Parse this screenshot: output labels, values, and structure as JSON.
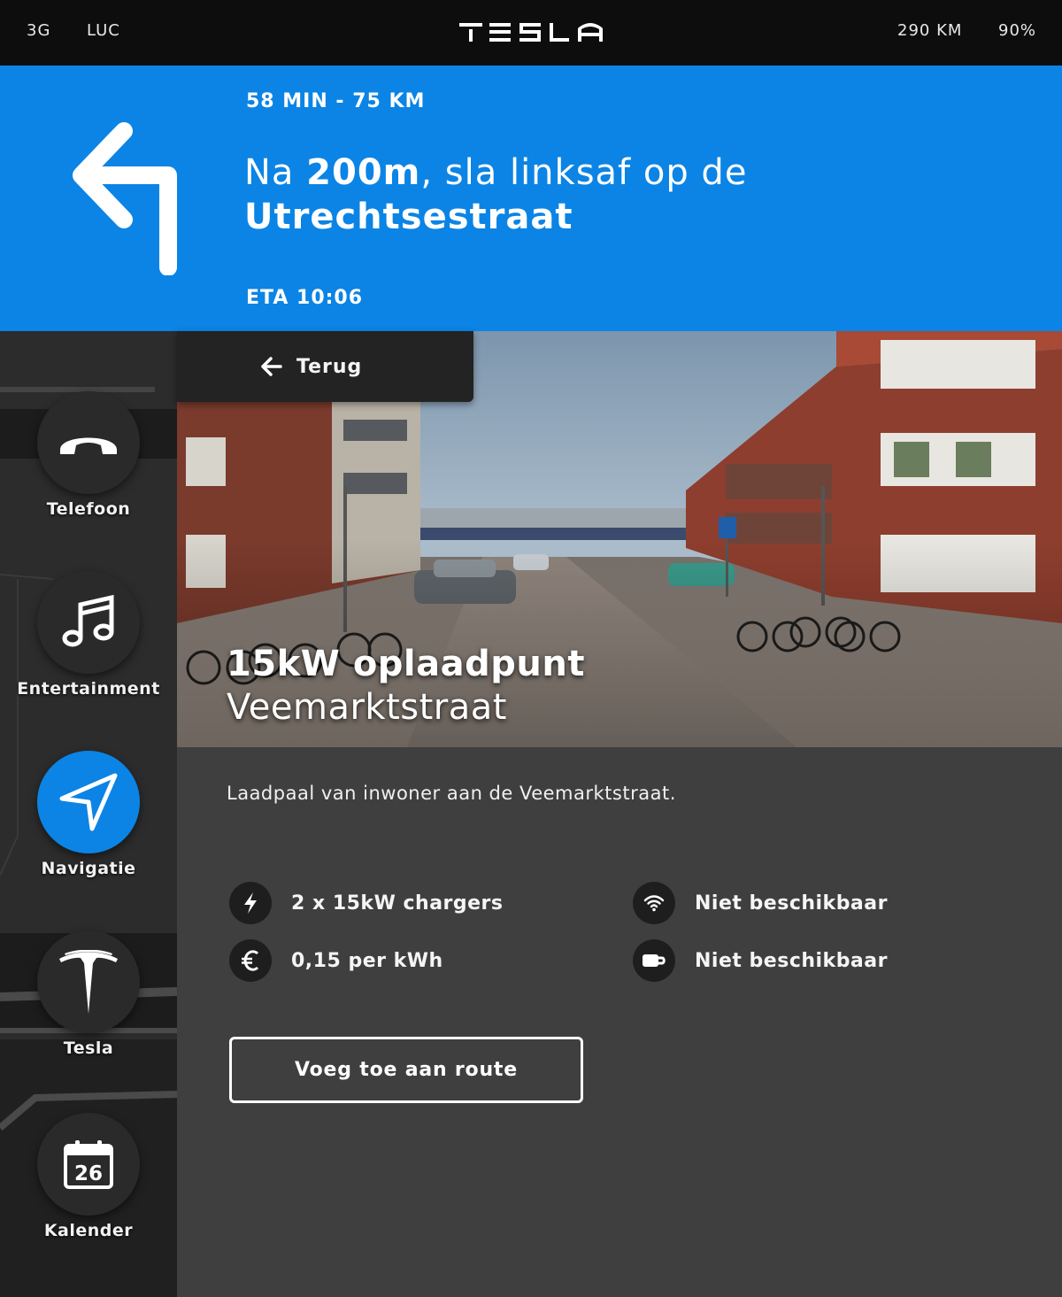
{
  "status_bar": {
    "network": "3G",
    "driver": "LUC",
    "brand": "TESLA",
    "range": "290 KM",
    "battery": "90%"
  },
  "navigation": {
    "duration_distance": "58 MIN - 75 KM",
    "instruction_prefix": "Na ",
    "instruction_distance": "200m",
    "instruction_middle": ", sla linksaf op de",
    "instruction_street": "Utrechtsestraat",
    "eta": "ETA 10:06",
    "turn_icon": "turn-left-arrow-icon"
  },
  "dock": [
    {
      "label": "Telefoon",
      "icon": "phone-icon",
      "active": false
    },
    {
      "label": "Entertainment",
      "icon": "music-note-icon",
      "active": false
    },
    {
      "label": "Navigatie",
      "icon": "navigation-arrow-icon",
      "active": true
    },
    {
      "label": "Tesla",
      "icon": "tesla-logo-icon",
      "active": false
    },
    {
      "label": "Kalender",
      "icon": "calendar-icon",
      "active": false,
      "calendar_day": "26"
    }
  ],
  "poi": {
    "back_label": "Terug",
    "title": "15kW oplaadpunt",
    "street": "Veemarktstraat",
    "description": "Laadpaal van inwoner aan de Veemarktstraat.",
    "features": [
      {
        "icon": "lightning-icon",
        "text": "2 x 15kW chargers"
      },
      {
        "icon": "wifi-icon",
        "text": "Niet beschikbaar"
      },
      {
        "icon": "euro-icon",
        "text": "0,15 per kWh"
      },
      {
        "icon": "coffee-cup-icon",
        "text": "Niet beschikbaar"
      }
    ],
    "add_route_label": "Voeg toe aan route"
  },
  "colors": {
    "accent": "#0b84e5",
    "status_bar": "#0d0d0d",
    "panel": "#3f3f3f",
    "sidebar": "#2d2d2d"
  }
}
